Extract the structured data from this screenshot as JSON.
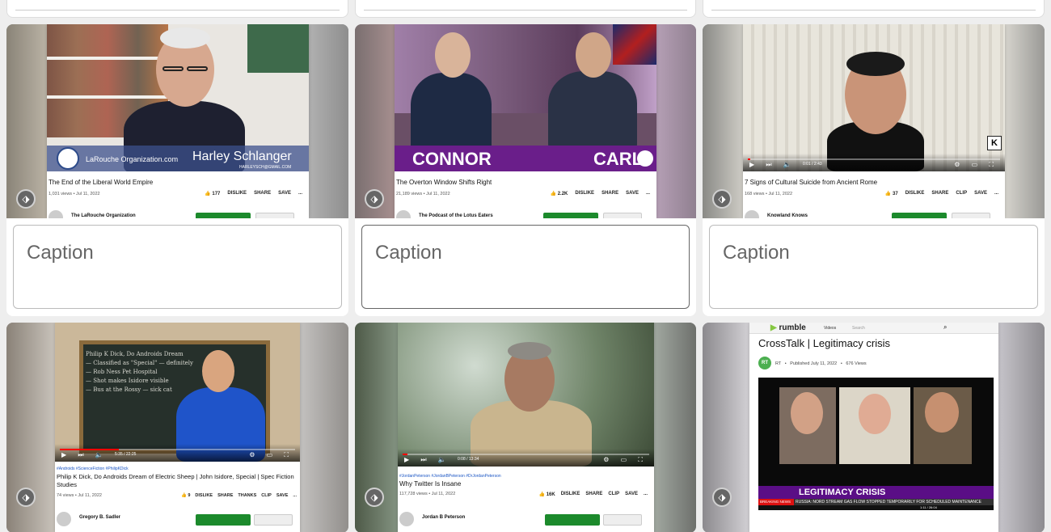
{
  "cards": [
    {
      "video_title": "The End of the Liberal World Empire",
      "meta": "1,031 views • Jul 11, 2022",
      "actions": [
        "👍 177",
        "DISLIKE",
        "SHARE",
        "SAVE",
        "..."
      ],
      "channel": "The LaRouche Organization",
      "overlay_site": "LaRouche Organization.com",
      "overlay_name": "Harley Schlanger",
      "overlay_email": "HARLEYSCH@GMAIL.COM",
      "caption_placeholder": "Caption"
    },
    {
      "video_title": "The Overton Window Shifts Right",
      "meta": "21,189 views • Jul 11, 2022",
      "actions": [
        "👍 2.2K",
        "DISLIKE",
        "SHARE",
        "SAVE",
        "..."
      ],
      "channel": "The Podcast of the Lotus Eaters",
      "overlay_left": "CONNOR",
      "overlay_right": "CARL",
      "caption_placeholder": "Caption"
    },
    {
      "video_title": "7 Signs of Cultural Suicide from Ancient Rome",
      "meta": "168 views • Jul 11, 2022",
      "actions": [
        "👍 37",
        "DISLIKE",
        "SHARE",
        "CLIP",
        "SAVE",
        "..."
      ],
      "channel": "Knowland Knows",
      "time": "0:01 / 2:43",
      "caption_placeholder": "Caption"
    },
    {
      "hashtags": "#Androids #ScienceFiction #PhilipKDick",
      "video_title": "Philip K Dick, Do Androids Dream of Electric Sheep | John Isidore, Special | Spec Fiction Studies",
      "meta": "74 views • Jul 11, 2022",
      "actions": [
        "👍 9",
        "DISLIKE",
        "SHARE",
        "THANKS",
        "CLIP",
        "SAVE",
        "..."
      ],
      "channel": "Gregory B. Sadler",
      "time": "5:35 / 22:25"
    },
    {
      "hashtags": "#JordanPeterson #JordanBPeterson #DrJordanPeterson",
      "video_title": "Why Twitter Is Insane",
      "meta": "117,728 views • Jul 11, 2022",
      "actions": [
        "👍 16K",
        "DISLIKE",
        "SHARE",
        "CLIP",
        "SAVE",
        "..."
      ],
      "channel": "Jordan B Peterson",
      "time": "0:08 / 13:34"
    },
    {
      "site": "rumble",
      "nav_videos": "Videos",
      "search_placeholder": "Search",
      "video_title": "CrossTalk | Legitimacy crisis",
      "channel": "RT",
      "published": "Published July 11, 2022",
      "views": "676 Views",
      "banner": "LEGITIMACY CRISIS",
      "breaking": "BREAKING NEWS",
      "ticker": "RUSSIA: NORD STREAM GAS FLOW STOPPED TEMPORARILY FOR SCHEDULED MAINTENANCE",
      "time": "1:11 / 26:04"
    }
  ],
  "tag_icon": "tag-icon"
}
